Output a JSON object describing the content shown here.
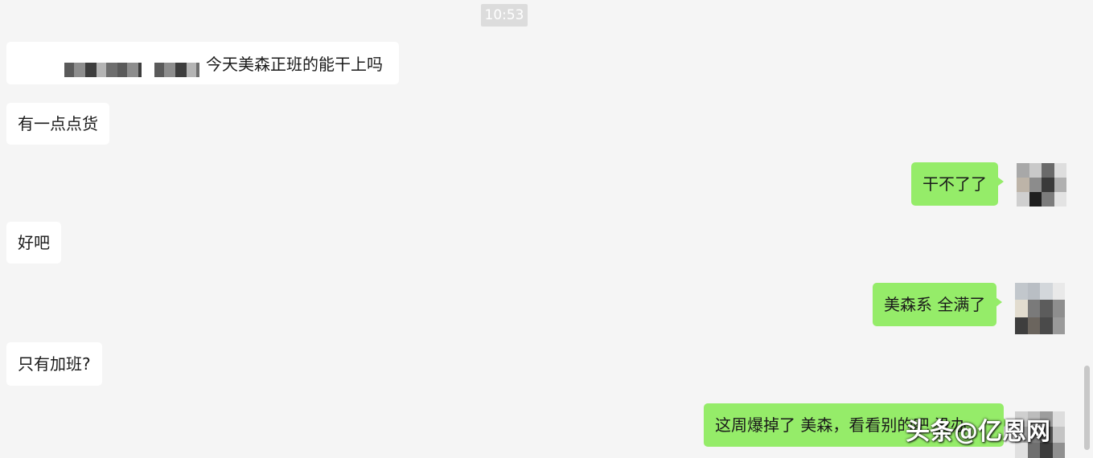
{
  "chat": {
    "timestamp": "10:53",
    "messages": [
      {
        "side": "in",
        "text": "今天美森正班的能干上吗"
      },
      {
        "side": "in",
        "text": "有一点点货"
      },
      {
        "side": "out",
        "text": "干不了了"
      },
      {
        "side": "in",
        "text": "好吧"
      },
      {
        "side": "out",
        "text": "美森系 全满了"
      },
      {
        "side": "in",
        "text": "只有加班?"
      },
      {
        "side": "out",
        "text": "这周爆掉了 美森，看看别的吧 没办"
      }
    ]
  },
  "watermark": {
    "text": "头条@亿恩网"
  },
  "colors": {
    "background": "#f5f5f5",
    "incoming_bubble": "#ffffff",
    "outgoing_bubble": "#95ec69",
    "timestamp_badge": "#dcdcdc"
  }
}
